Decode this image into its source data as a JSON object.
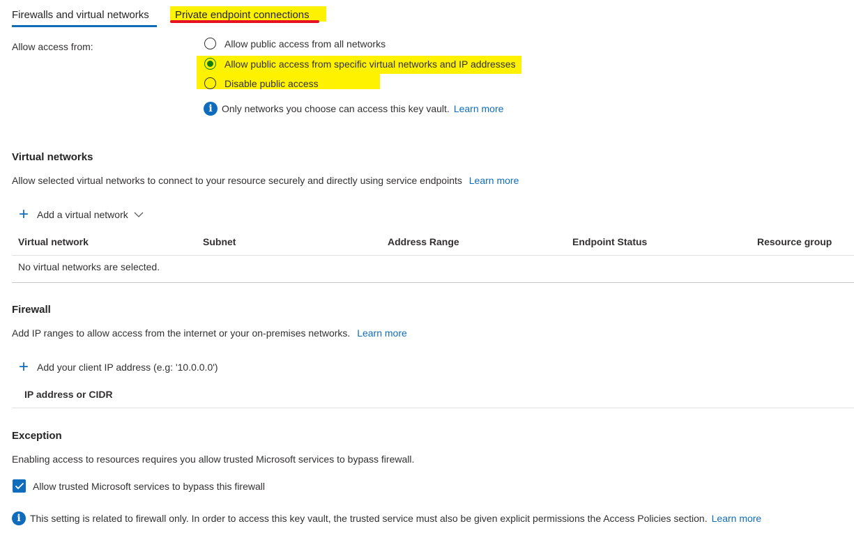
{
  "tabs": {
    "firewalls": "Firewalls and virtual networks",
    "private_endpoint": "Private endpoint connections"
  },
  "access": {
    "label": "Allow access from:",
    "options": [
      "Allow public access from all networks",
      "Allow public access from specific virtual networks and IP addresses",
      "Disable public access"
    ],
    "selected_index": 1,
    "info_text": "Only networks you choose can access this key vault.",
    "info_link": "Learn more"
  },
  "virtual_networks": {
    "title": "Virtual networks",
    "description": "Allow selected virtual networks to connect to your resource securely and directly using service endpoints",
    "link": "Learn more",
    "add_label": "Add a virtual network",
    "columns": [
      "Virtual network",
      "Subnet",
      "Address Range",
      "Endpoint Status",
      "Resource group"
    ],
    "empty_text": "No virtual networks are selected."
  },
  "firewall": {
    "title": "Firewall",
    "description": "Add IP ranges to allow access from the internet or your on-premises networks.",
    "link": "Learn more",
    "add_label": "Add your client IP address (e.g: '10.0.0.0')",
    "column": "IP address or CIDR"
  },
  "exception": {
    "title": "Exception",
    "description": "Enabling access to resources requires you allow trusted Microsoft services to bypass firewall.",
    "checkbox_label": "Allow trusted Microsoft services to bypass this firewall",
    "checked": true,
    "info_text": "This setting is related to firewall only. In order to access this key vault, the trusted service must also be given explicit permissions the Access Policies section.",
    "info_link": "Learn more"
  },
  "colors": {
    "accent": "#0f6cbd",
    "highlight": "#fff200",
    "annotation_red": "#e81123",
    "radio_selected": "#107c10"
  }
}
